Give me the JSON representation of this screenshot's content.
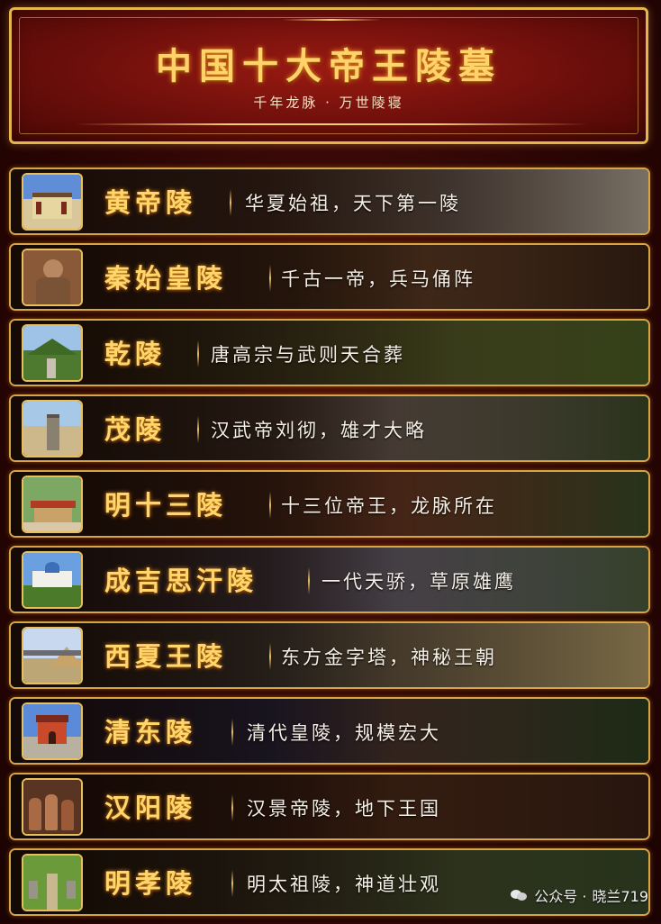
{
  "header": {
    "title": "中国十大帝王陵墓",
    "subtitle": "千年龙脉 · 万世陵寝"
  },
  "mausoleums": [
    {
      "name": "黄帝陵",
      "desc": "华夏始祖，天下第一陵",
      "icon": "temple-photo-icon"
    },
    {
      "name": "秦始皇陵",
      "desc": "千古一帝，兵马俑阵",
      "icon": "terracotta-warrior-photo-icon"
    },
    {
      "name": "乾陵",
      "desc": "唐高宗与武则天合葬",
      "icon": "mountain-tomb-photo-icon"
    },
    {
      "name": "茂陵",
      "desc": "汉武帝刘彻，雄才大略",
      "icon": "stone-stele-photo-icon"
    },
    {
      "name": "明十三陵",
      "desc": "十三位帝王，龙脉所在",
      "icon": "ming-tombs-photo-icon"
    },
    {
      "name": "成吉思汗陵",
      "desc": "一代天骄，草原雄鹰",
      "icon": "mongol-palace-photo-icon"
    },
    {
      "name": "西夏王陵",
      "desc": "东方金字塔，神秘王朝",
      "icon": "earthen-pyramid-photo-icon"
    },
    {
      "name": "清东陵",
      "desc": "清代皇陵，规模宏大",
      "icon": "qing-gate-photo-icon"
    },
    {
      "name": "汉阳陵",
      "desc": "汉景帝陵，地下王国",
      "icon": "pottery-figures-photo-icon"
    },
    {
      "name": "明孝陵",
      "desc": "明太祖陵，神道壮观",
      "icon": "sacred-way-photo-icon"
    }
  ],
  "watermark": {
    "prefix": "公众号 ·",
    "account": "晓兰719",
    "icon": "wechat-icon"
  },
  "colors": {
    "gold": "#e6b44c",
    "title_gold": "#ffd36a",
    "background_red": "#4a0d0a"
  }
}
